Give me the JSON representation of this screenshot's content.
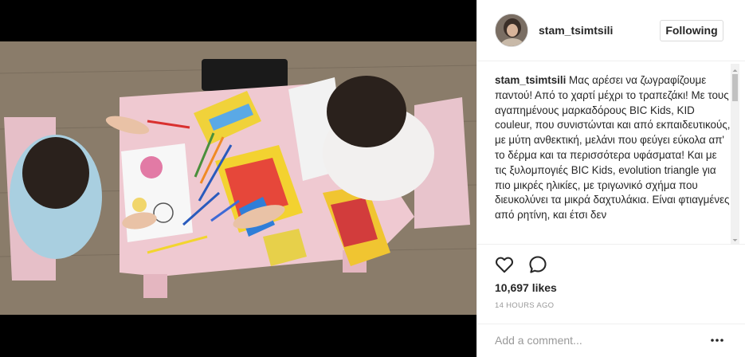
{
  "post": {
    "username": "stam_tsimtsili",
    "follow_label": "Following",
    "caption_username": "stam_tsimtsili",
    "caption_text": "Μας αρέσει να ζωγραφίζουμε παντού! Από το χαρτί μέχρι το τραπεζάκι! Με τους αγαπημένους μαρκαδόρους BIC Kids, KID couleur, που συνιστώνται και από εκπαιδευτικούς, με μύτη ανθεκτική, μελάνι που φεύγει εύκολα απ' το δέρμα και τα περισσότερα υφάσματα! Και με τις ξυλομπογιές BIC Kids, evolution triangle για πιο μικρές ηλικίες, με τριγωνικό σχήμα που διευκολύνει τα μικρά δαχτυλάκια. Είναι φτιαγμένες από ρητίνη, και έτσι δεν",
    "likes": "10,697 likes",
    "timestamp": "14 HOURS AGO"
  },
  "comment": {
    "placeholder": "Add a comment..."
  },
  "icons": {
    "like": "heart-icon",
    "comment": "speech-bubble-icon",
    "more": "more-dots-icon",
    "scroll_up": "scroll-up-arrow-icon",
    "scroll_down": "scroll-down-arrow-icon"
  },
  "colors": {
    "text": "#262626",
    "muted": "#999999",
    "border": "#dbdbdb",
    "divider": "#efefef",
    "media_background": "#000000"
  }
}
